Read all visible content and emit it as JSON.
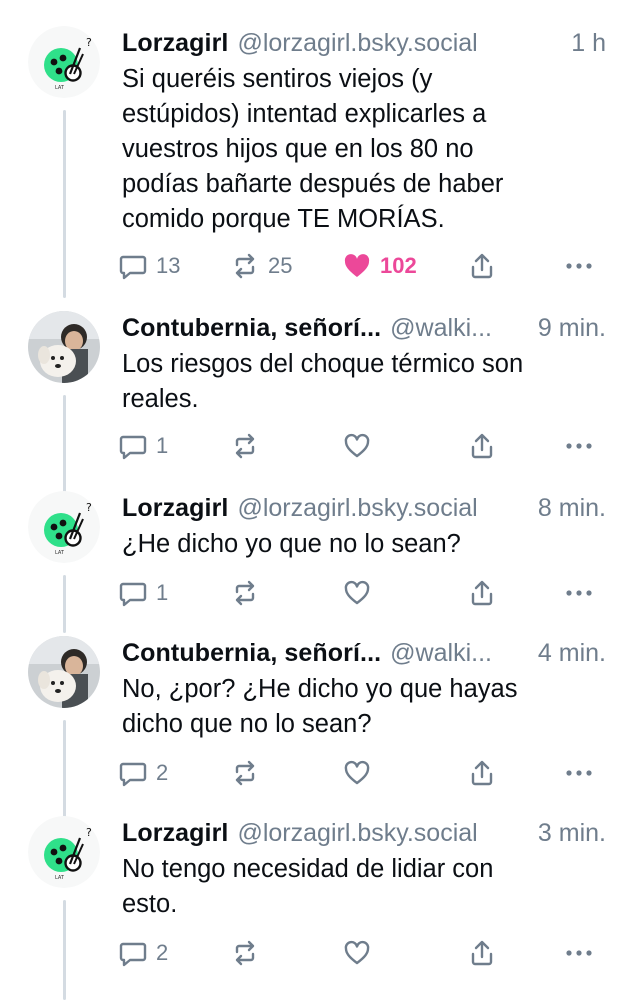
{
  "thread": {
    "posts": [
      {
        "author": "Lorzagirl",
        "handle": "@lorzagirl.bsky.social",
        "time": "1 h",
        "text": "Si queréis sentiros viejos (y\nestúpidos) intentad explicarles a\nvuestros hijos que en los 80 no\npodías bañarte después de haber\ncomido porque TE MORÍAS.",
        "replies": "13",
        "reposts": "25",
        "likes": "102",
        "avatar_icon": "ladybug-question-avatar"
      },
      {
        "author": "Contubernia, señorí...",
        "handle": "@walki...",
        "time": "9 min.",
        "text": "Los riesgos del choque térmico son\nreales.",
        "replies": "1",
        "reposts": "",
        "likes": "",
        "avatar_icon": "person-with-dog-avatar"
      },
      {
        "author": "Lorzagirl",
        "handle": "@lorzagirl.bsky.social",
        "time": "8 min.",
        "text": "¿He dicho yo que no lo sean?",
        "replies": "1",
        "reposts": "",
        "likes": "",
        "avatar_icon": "ladybug-question-avatar"
      },
      {
        "author": "Contubernia, señorí...",
        "handle": "@walki...",
        "time": "4 min.",
        "text": "No, ¿por? ¿He dicho yo que hayas\ndicho que no lo sean?",
        "replies": "2",
        "reposts": "",
        "likes": "",
        "avatar_icon": "person-with-dog-avatar"
      },
      {
        "author": "Lorzagirl",
        "handle": "@lorzagirl.bsky.social",
        "time": "3 min.",
        "text": "No tengo necesidad de lidiar con\nesto.",
        "replies": "2",
        "reposts": "",
        "likes": "",
        "avatar_icon": "ladybug-question-avatar"
      }
    ]
  },
  "icons": {
    "reply": "speech-bubble-icon",
    "repost": "repost-arrows-icon",
    "like": "heart-icon",
    "share": "share-upload-icon",
    "more": "ellipsis-icon"
  },
  "colors": {
    "like_active": "#ec4899",
    "muted_text": "#6f7d8c",
    "thread_line": "#d4dbe2",
    "avatar_green": "#2fe08a"
  }
}
